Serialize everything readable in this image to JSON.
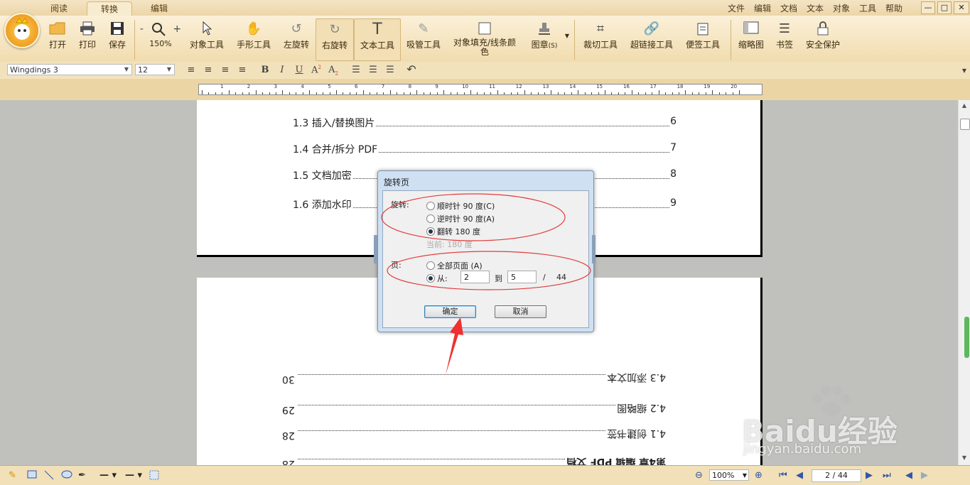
{
  "tabs": [
    {
      "label": "阅读"
    },
    {
      "label": "转换"
    },
    {
      "label": "编辑"
    }
  ],
  "menu": [
    "文件",
    "编辑",
    "文档",
    "文本",
    "对象",
    "工具",
    "帮助"
  ],
  "window": {
    "min": "—",
    "max": "□",
    "close": "✕"
  },
  "toolbar": {
    "open": "打开",
    "print": "打印",
    "save": "保存",
    "zoom_out": "-",
    "zoom_in": "+",
    "zoom": "150%",
    "object_tool": "对象工具",
    "hand_tool": "手形工具",
    "rotate_left": "左旋转",
    "rotate_right": "右旋转",
    "text_tool": "文本工具",
    "eyedropper": "吸管工具",
    "fill_color_line1": "对象填充/线条颜",
    "fill_color_line2": "色",
    "stamp": "图章",
    "stamp_shortcut": "(S)",
    "crop": "裁切工具",
    "hyperlink": "超链接工具",
    "sticky": "便签工具",
    "thumbnail": "缩略图",
    "bookmark": "书签",
    "security": "安全保护"
  },
  "format": {
    "font": "Wingdings 3",
    "size": "12"
  },
  "ruler_labels": [
    "1",
    "2",
    "3",
    "4",
    "5",
    "6",
    "7",
    "8",
    "9",
    "10",
    "11",
    "12",
    "13",
    "14",
    "15",
    "16",
    "17",
    "18",
    "19",
    "20"
  ],
  "toc_top": [
    {
      "title": "1.3 插入/替换图片",
      "page": "6"
    },
    {
      "title": "1.4 合并/拆分 PDF",
      "page": "7"
    },
    {
      "title": "1.5 文档加密",
      "page": "8"
    },
    {
      "title": "1.6 添加水印",
      "page": "9"
    }
  ],
  "toc_bottom": [
    {
      "title": "4.3 添加文本",
      "page": "30"
    },
    {
      "title": "4.2 缩略图",
      "page": "29"
    },
    {
      "title": "4.1 创建书签",
      "page": "28"
    },
    {
      "title": "第4章 编辑 PDF 文档",
      "page": "28"
    }
  ],
  "dialog": {
    "title": "旋转页",
    "rotate_label": "旋转:",
    "options": [
      "顺时针 90 度(C)",
      "逆时针 90 度(A)",
      "翻转 180 度"
    ],
    "current": "当前:  180 度",
    "page_label": "页:",
    "all_pages": "全部页面 (A)",
    "from": "从:",
    "from_value": "2",
    "to": "到",
    "to_value": "5",
    "slash": "/",
    "total": "44",
    "ok": "确定",
    "cancel": "取消"
  },
  "status": {
    "zoom": "100%",
    "page": "2 / 44"
  },
  "watermark": {
    "brand": "Baidu经验",
    "url": "jingyan.baidu.com"
  }
}
